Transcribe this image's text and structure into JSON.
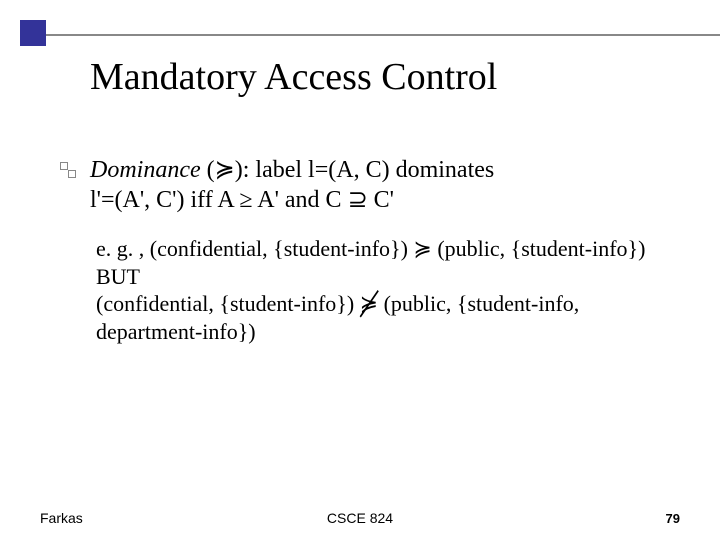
{
  "title": "Mandatory Access Control",
  "dominance": {
    "lead": "Dominance",
    "symbol": " (≽): ",
    "rest1": "label l=(A, C) dominates",
    "rest2": "l'=(A', C') iff  A ≥ A' and C ⊇ C'"
  },
  "example": {
    "line1": "e. g. , (confidential, {student-info}) ≽ (public, {student-info})",
    "but": "BUT",
    "line3a": "(confidential, {student-info}) ",
    "strike": "≽",
    "line3b": " (public, {student-info,",
    "line4": "department-info})"
  },
  "footer": {
    "left": "Farkas",
    "center": "CSCE 824",
    "page": "79"
  }
}
